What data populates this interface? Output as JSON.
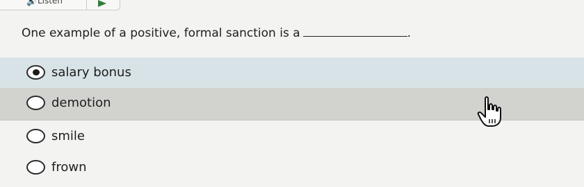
{
  "toolbar": {
    "listen_label": "Listen",
    "speaker_icon": "speaker-icon",
    "play_icon": "play-icon",
    "accent": "#2f7d3a"
  },
  "question": {
    "text": "One example of a positive, formal sanction is a",
    "trailing": "."
  },
  "options": [
    {
      "label": "salary bonus",
      "selected": true
    },
    {
      "label": "demotion",
      "selected": false
    },
    {
      "label": "smile",
      "selected": false
    },
    {
      "label": "frown",
      "selected": false
    }
  ],
  "colors": {
    "selected_row": "#d8e3e7",
    "hover_row": "#d2d2cf"
  }
}
